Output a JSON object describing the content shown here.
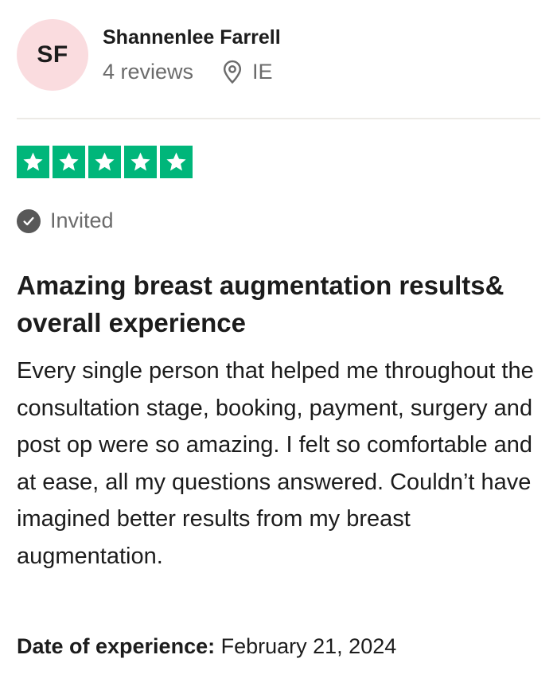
{
  "reviewer": {
    "initials": "SF",
    "name": "Shannenlee Farrell",
    "review_count": "4 reviews",
    "country": "IE",
    "avatar_color": "#fadcdf"
  },
  "rating": {
    "stars": 5,
    "max": 5,
    "star_color": "#00b67a"
  },
  "badge": {
    "label": "Invited",
    "icon": "check-circle-icon"
  },
  "review": {
    "title": "Amazing breast augmentation results& overall experience",
    "body": "Every single person that helped me throughout the consultation stage, booking, payment, surgery and post op were so amazing. I felt so comfortable and at ease, all my questions answered. Couldn’t have imagined better results from my breast augmentation."
  },
  "experience": {
    "label": "Date of experience:",
    "date": "February 21, 2024"
  }
}
